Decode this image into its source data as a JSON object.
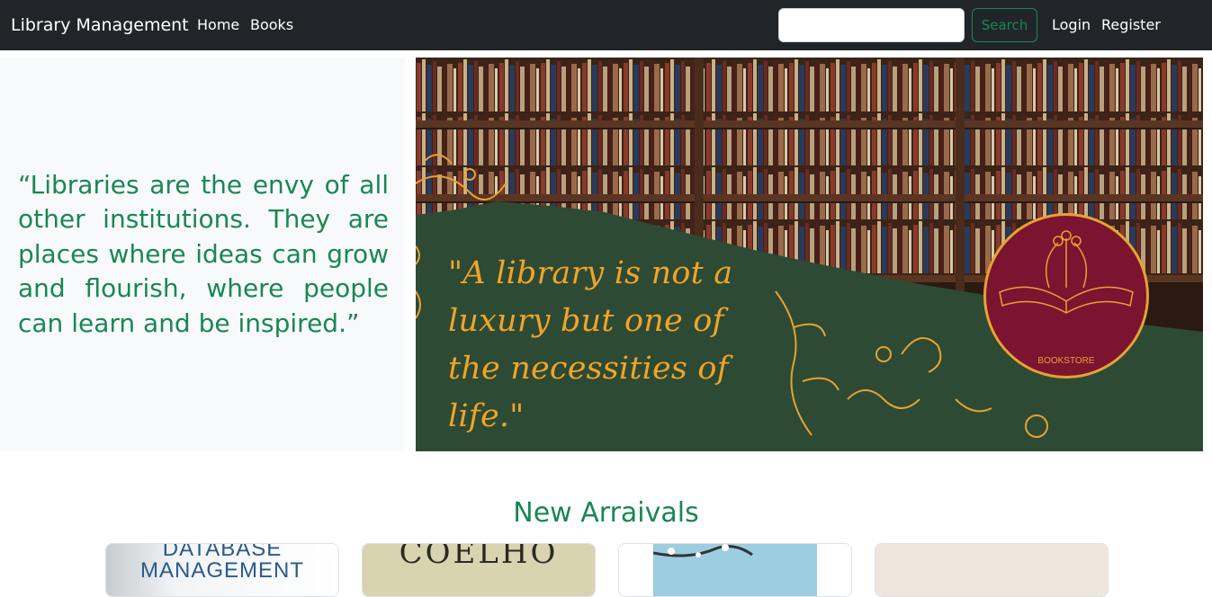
{
  "navbar": {
    "brand": "Library Management",
    "links": [
      "Home",
      "Books"
    ],
    "search_placeholder": "",
    "search_value": "",
    "search_button": "Search",
    "auth_links": [
      "Login",
      "Register"
    ]
  },
  "hero": {
    "quote": "“Libraries are the envy of all other institutions. They are places where ideas can grow and flourish, where people can learn and be inspired.”",
    "banner": {
      "quote": "\"A library is not a luxury but one of the necessities of life.\"",
      "badge_label": "BOOKSTORE",
      "colors": {
        "green": "#2d4a34",
        "gold": "#f0a428",
        "maroon": "#7a1430"
      }
    }
  },
  "new_arrivals": {
    "title": "New Arraivals",
    "cards": [
      {
        "cover_text": "DATABASE MANAGEMENT"
      },
      {
        "cover_text": "COELHO"
      },
      {
        "cover_text": ""
      },
      {
        "cover_text": ""
      }
    ]
  },
  "colors": {
    "accent": "#198754",
    "navbar_bg": "#212529"
  }
}
